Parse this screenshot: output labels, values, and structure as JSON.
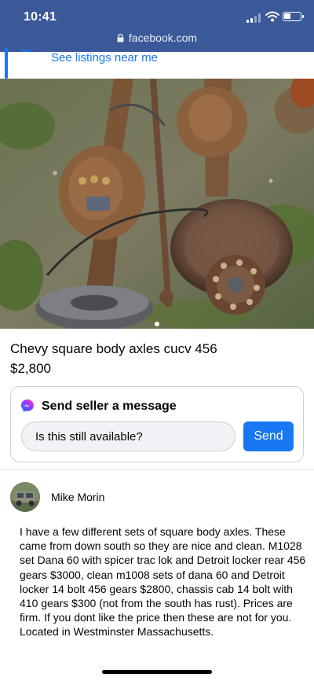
{
  "status_bar": {
    "time": "10:41",
    "url": "facebook.com"
  },
  "nav": {
    "listings_link": "See listings near me"
  },
  "listing": {
    "photo_count": 1,
    "active_photo": 1,
    "title": "Chevy square body axles cucv 456",
    "price": "$2,800"
  },
  "message_card": {
    "title": "Send seller a message",
    "input_value": "Is this still available?",
    "send_label": "Send"
  },
  "seller": {
    "name": "Mike Morin"
  },
  "description": "I have a few different sets of square body axles. These came from down south so they are nice and clean. M1028 set Dana 60 with spicer trac lok and Detroit locker rear 456 gears $3000, clean m1008 sets of dana 60 and Detroit locker 14 bolt 456 gears $2800, chassis cab 14 bolt with 410 gears $300 (not from the south has rust). Prices are firm. If you dont like the price then these are not for you. Located in Westminster Massachusetts.",
  "colors": {
    "status_bar": "#3b5998",
    "accent": "#1877f2",
    "text": "#050505"
  },
  "icons": [
    "signal-icon",
    "wifi-icon",
    "battery-icon",
    "lock-icon",
    "messenger-icon"
  ]
}
